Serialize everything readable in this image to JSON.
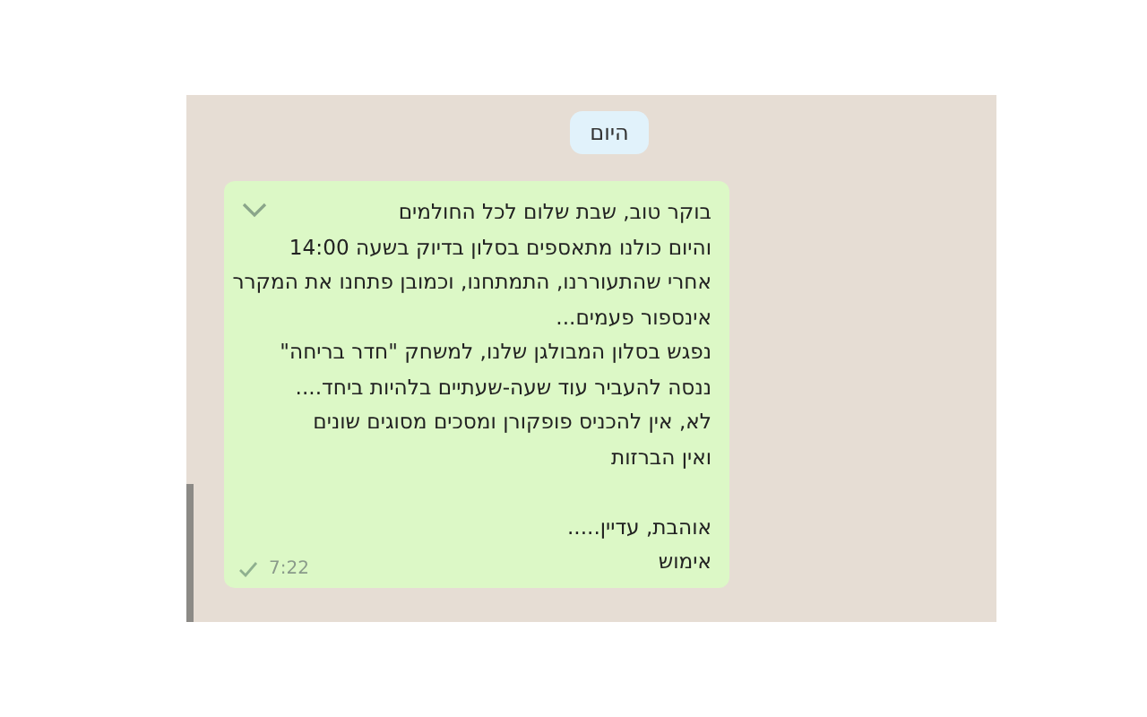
{
  "date_badge": "היום",
  "message": {
    "paragraphs": [
      [
        "בוקר טוב, שבת שלום לכל החולמים",
        "והיום כולנו מתאספים בסלון בדיוק בשעה 14:00",
        "אחרי שהתעוררנו, התמתחנו, וכמובן פתחנו את המקרר",
        "אינספור פעמים...",
        "נפגש בסלון המבולגן שלנו, למשחק \"חדר בריחה\"",
        "ננסה להעביר עוד שעה-שעתיים בלהיות ביחד....",
        "לא, אין להכניס פופקורן ומסכים מסוגים שונים",
        "ואין הברזות"
      ],
      [
        "אוהבת, עדיין.....",
        "אימוש"
      ]
    ],
    "time": "7:22",
    "delivered": true
  }
}
